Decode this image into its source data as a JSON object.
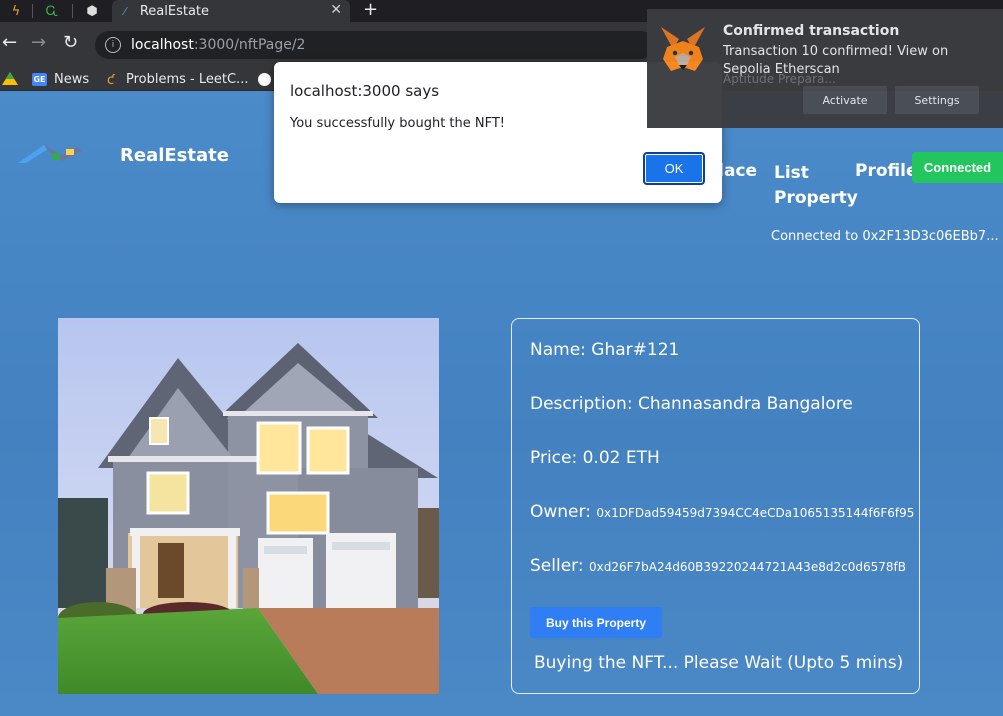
{
  "browser": {
    "tab_title": "RealEstate",
    "url_host": "localhost",
    "url_path": ":3000/nftPage/2",
    "bookmarks": [
      "News",
      "Problems - LeetC..."
    ],
    "bookmark_icon_label": "GE"
  },
  "site": {
    "brand": "RealEstate",
    "nav": {
      "marketplace_partial": "place",
      "list_property_1": "List",
      "list_property_2": "Property",
      "profile": "Profile"
    },
    "connect_button": "Connected",
    "connected_to": "Connected to 0x2F13D3c06EBb7..."
  },
  "nft": {
    "name_label": "Name: ",
    "name": "Ghar#121",
    "description_label": "Description: ",
    "description": "Channasandra Bangalore",
    "price_label": "Price: ",
    "price": "0.02 ETH",
    "owner_label": "Owner: ",
    "owner": "0x1DFDad59459d7394CC4eCDa1065135144f6F6f95",
    "seller_label": "Seller: ",
    "seller": "0xd26F7bA24d60B39220244721A43e8d2c0d6578fB",
    "buy_button": "Buy this Property",
    "status": "Buying the NFT... Please Wait (Upto 5 mins)"
  },
  "dialog": {
    "title": "localhost:3000 says",
    "message": "You successfully bought the NFT!",
    "ok": "OK"
  },
  "notification": {
    "title": "Confirmed transaction",
    "body": "Transaction 10 confirmed! View on Sepolia Etherscan",
    "background_text": "Aptitude Prepara...",
    "activate": "Activate",
    "settings": "Settings"
  },
  "colors": {
    "page_bg": "#4a86c4",
    "connected_green": "#22c55e",
    "buy_blue": "#2f7ef4",
    "dialog_ok_blue": "#1a73e8"
  }
}
